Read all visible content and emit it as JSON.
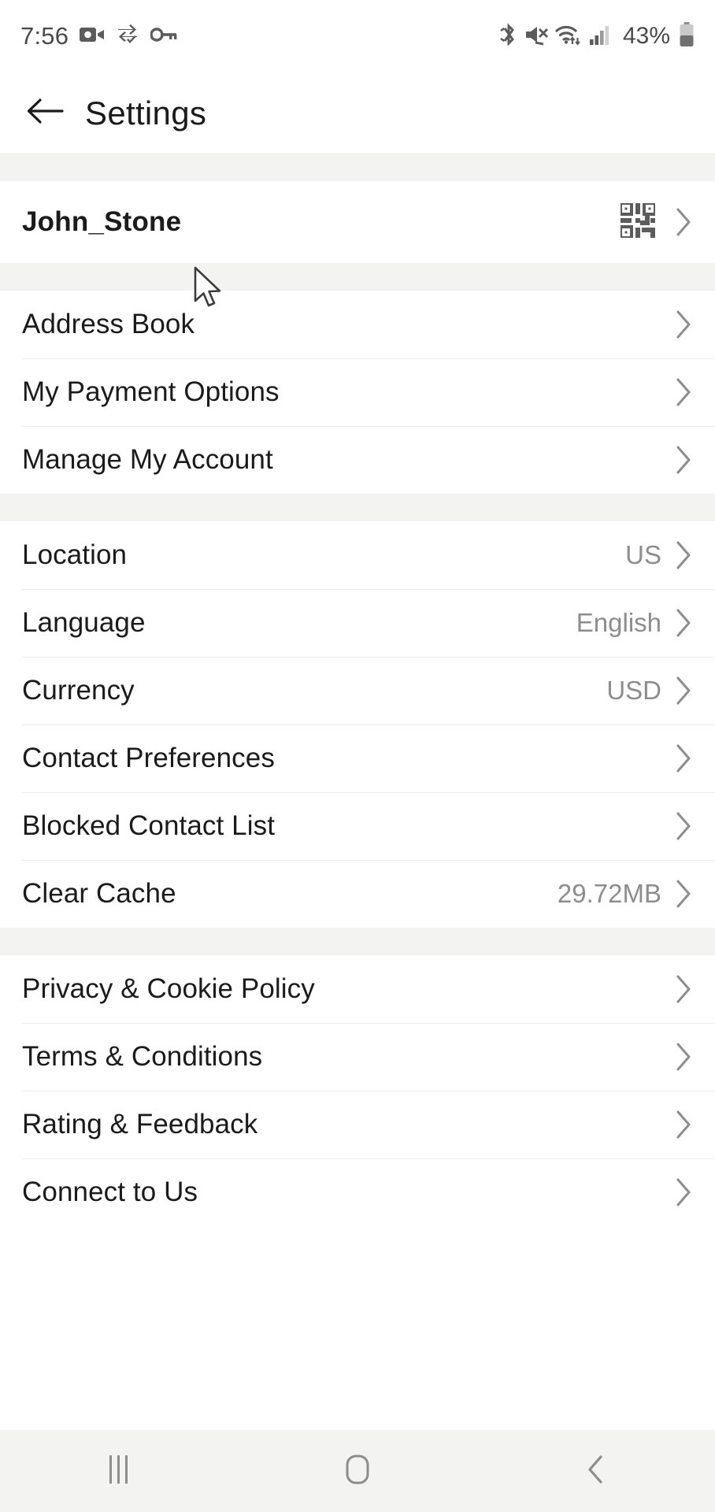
{
  "status_bar": {
    "time": "7:56",
    "battery_percent": "43%",
    "left_icons": [
      "video-camera-icon",
      "data-sync-icon",
      "vpn-key-icon"
    ],
    "right_icons": [
      "bluetooth-icon",
      "volume-muted-icon",
      "wifi-icon",
      "cellular-signal-icon",
      "battery-icon"
    ]
  },
  "app_bar": {
    "back_icon": "arrow-left-icon",
    "title": "Settings"
  },
  "account": {
    "username": "John_Stone",
    "qr_icon": "qr-code-icon",
    "chevron": "chevron-right-icon"
  },
  "sections": [
    {
      "name": "account-section",
      "rows": [
        {
          "label": "Address Book",
          "value": ""
        },
        {
          "label": "My Payment Options",
          "value": ""
        },
        {
          "label": "Manage My Account",
          "value": ""
        }
      ]
    },
    {
      "name": "preferences-section",
      "rows": [
        {
          "label": "Location",
          "value": "US"
        },
        {
          "label": "Language",
          "value": "English"
        },
        {
          "label": "Currency",
          "value": "USD"
        },
        {
          "label": "Contact Preferences",
          "value": ""
        },
        {
          "label": "Blocked Contact List",
          "value": ""
        },
        {
          "label": "Clear Cache",
          "value": "29.72MB"
        }
      ]
    },
    {
      "name": "legal-section",
      "rows": [
        {
          "label": "Privacy & Cookie Policy",
          "value": ""
        },
        {
          "label": "Terms & Conditions",
          "value": ""
        },
        {
          "label": "Rating & Feedback",
          "value": ""
        },
        {
          "label": "Connect to Us",
          "value": ""
        }
      ]
    }
  ],
  "nav_bar": {
    "recents_icon": "recents-icon",
    "home_icon": "home-icon",
    "back_icon": "back-chevron-icon"
  },
  "colors": {
    "background": "#ffffff",
    "band": "#f3f4f2",
    "label_text": "#1b1b1b",
    "value_text": "#8d8d8d",
    "divider": "#ececec",
    "icon": "#5c5c5c"
  }
}
